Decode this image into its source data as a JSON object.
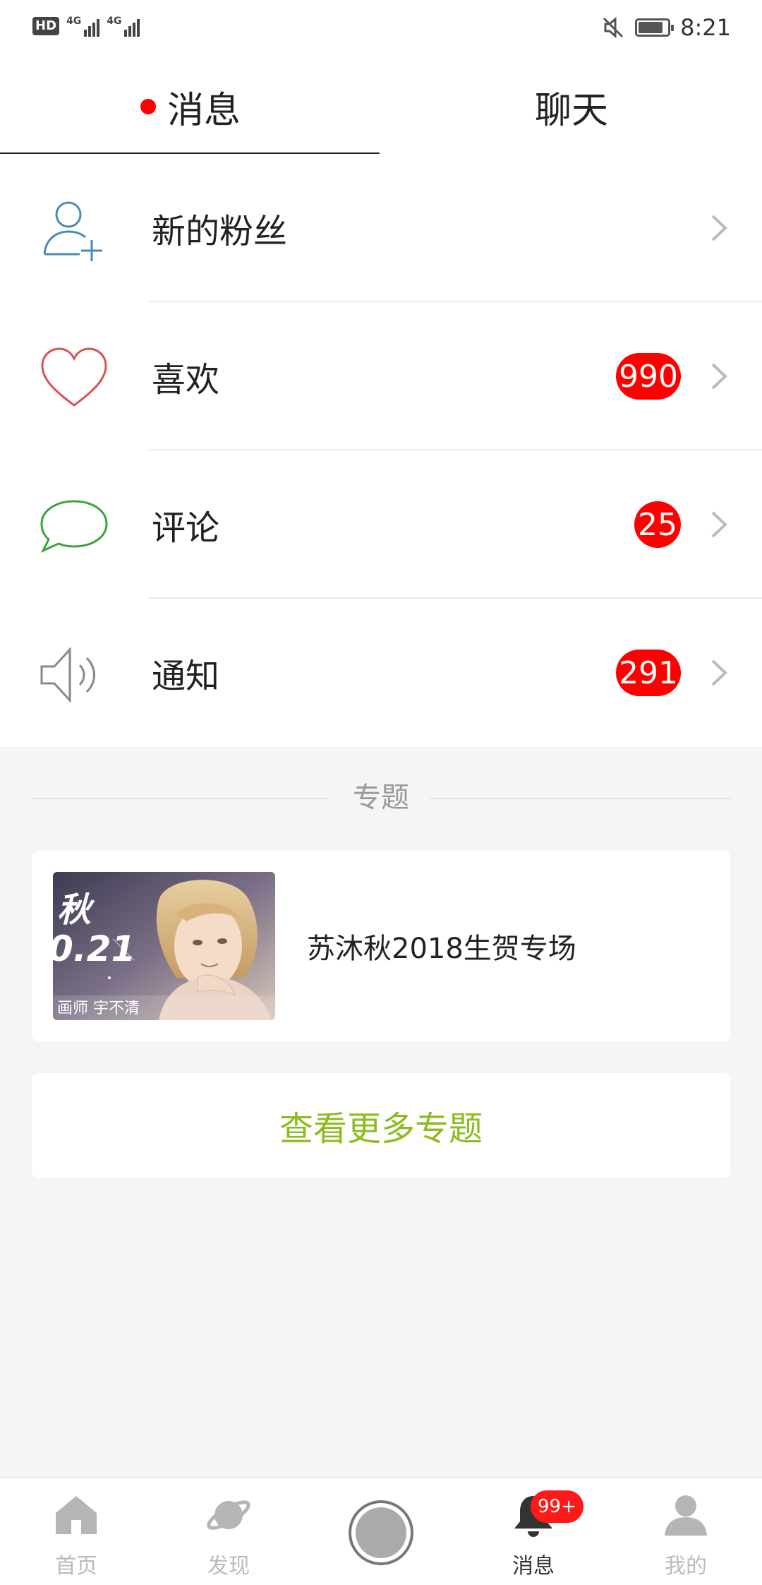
{
  "status_bar": {
    "network_badge": "HD",
    "sim1": "4G",
    "sim2": "4G",
    "time": "8:21",
    "icons": [
      "signal-icon",
      "mute-icon",
      "battery-icon"
    ],
    "battery_level": 0.8
  },
  "tabs": [
    {
      "label": "消息",
      "active": true,
      "has_dot": true
    },
    {
      "label": "聊天",
      "active": false,
      "has_dot": false
    }
  ],
  "list": [
    {
      "label": "新的粉丝",
      "icon": "add-user-icon",
      "badge": ""
    },
    {
      "label": "喜欢",
      "icon": "heart-icon",
      "badge": "990"
    },
    {
      "label": "评论",
      "icon": "comment-bubble-icon",
      "badge": "25"
    },
    {
      "label": "通知",
      "icon": "speaker-icon",
      "badge": "291"
    }
  ],
  "section": {
    "title": "专题"
  },
  "topic_card": {
    "title": "苏沐秋2018生贺专场",
    "thumb_text_1": "秋",
    "thumb_text_2": "0.21",
    "thumb_caption": "画师 宇不清"
  },
  "more_button": {
    "label": "查看更多专题"
  },
  "bottom_nav": [
    {
      "label": "首页",
      "icon": "home-icon"
    },
    {
      "label": "发现",
      "icon": "planet-icon"
    },
    {
      "label": "",
      "icon": "record-button-icon"
    },
    {
      "label": "消息",
      "icon": "bell-icon",
      "badge": "99+",
      "active": true
    },
    {
      "label": "我的",
      "icon": "profile-icon"
    }
  ],
  "colors": {
    "badge_red": "#ff0000",
    "accent_green": "#8dbb1d",
    "icon_blue": "#4a8ab8",
    "icon_red": "#d9534f",
    "icon_green": "#3ca53c"
  }
}
